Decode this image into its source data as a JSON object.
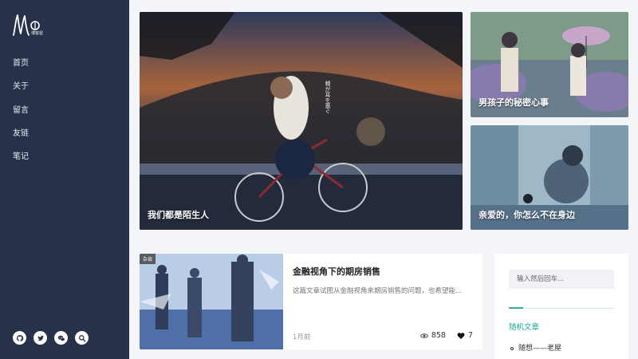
{
  "site": {
    "logo_sub": "博客屋"
  },
  "nav": {
    "items": [
      "首页",
      "关于",
      "留言",
      "友链",
      "笔记"
    ]
  },
  "socials": [
    "github-icon",
    "twitter-icon",
    "wechat-icon",
    "search-icon"
  ],
  "featured": {
    "main": {
      "title": "我们都是陌生人",
      "art_text": "蝉が耳を塞ぐ"
    },
    "top_right": {
      "title": "男孩子的秘密心事"
    },
    "bottom_right": {
      "title": "亲爱的，你怎么不在身边"
    }
  },
  "post": {
    "category": "杂谈",
    "title": "金融视角下的期房销售",
    "excerpt": "这篇文章试图从金融视角来期房销售的问题，也希望能...",
    "date": "1月前",
    "views": "858",
    "likes": "7"
  },
  "widget": {
    "search_placeholder": "输入然后回车...",
    "title": "随机文章",
    "items": [
      "随想——老屋"
    ]
  },
  "colors": {
    "sidebar": "#27324a",
    "accent": "#2bb0aa",
    "page_bg": "#f4f5f9"
  }
}
